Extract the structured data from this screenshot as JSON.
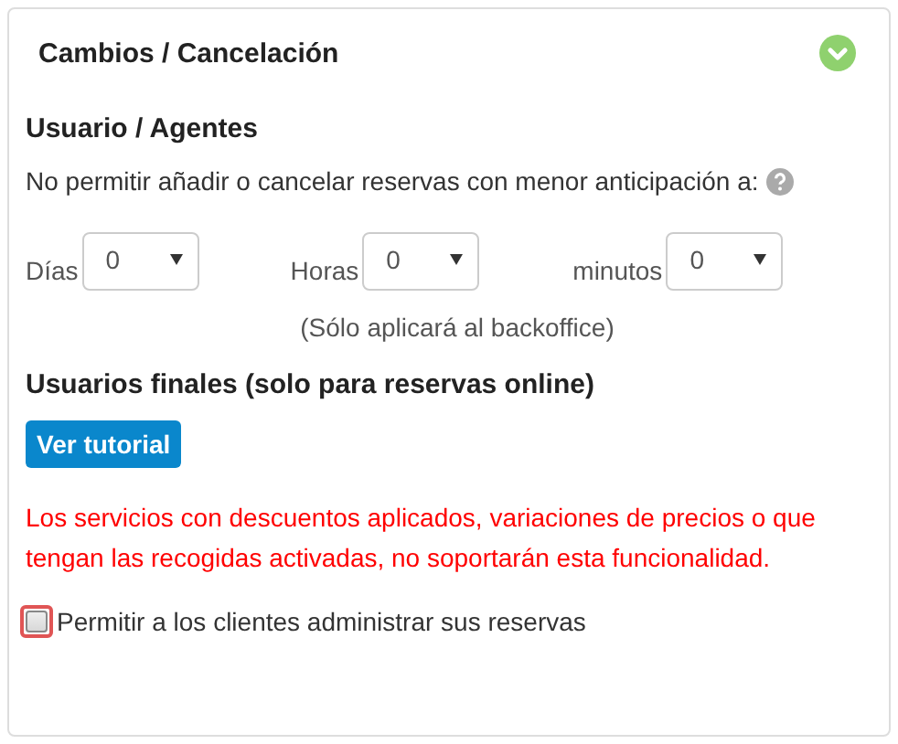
{
  "panel": {
    "title": "Cambios / Cancelación",
    "expanded": true
  },
  "agents": {
    "heading": "Usuario / Agentes",
    "description": "No permitir añadir o cancelar reservas con menor anticipación a:",
    "selects": [
      {
        "label": "Días",
        "value": "0"
      },
      {
        "label": "Horas",
        "value": "0"
      },
      {
        "label": "minutos",
        "value": "0"
      }
    ],
    "note": "(Sólo aplicará al backoffice)"
  },
  "end_users": {
    "heading": "Usuarios finales (solo para reservas online)",
    "button": "Ver tutorial",
    "warning": "Los servicios con descuentos aplicados, variaciones de precios o que tengan las recogidas activadas, no soportarán esta funcionalidad.",
    "checkbox": {
      "label": "Permitir a los clientes administrar sus reservas",
      "checked": false,
      "focused": true
    }
  }
}
